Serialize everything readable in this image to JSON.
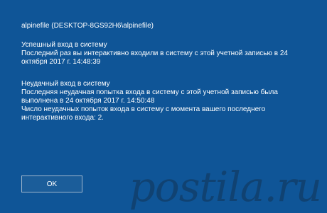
{
  "account": {
    "line": "alpinefile (DESKTOP-8GS92H6\\alpinefile)"
  },
  "success": {
    "title": "Успешный вход в систему",
    "text": "Последний раз вы интерактивно входили в систему с этой учетной записью в 24 октября 2017 г. 14:48:39"
  },
  "failure": {
    "title": "Неудачный вход в систему",
    "text": "Последняя неудачная попытка входа в систему с этой учетной записью была выполнена в 24 октября 2017 г. 14:50:48",
    "count_text": "Число неудачных попыток входа в систему с момента вашего последнего интерактивного входа: 2."
  },
  "buttons": {
    "ok_label": "OK"
  },
  "watermark": {
    "text": "postila.ru"
  }
}
